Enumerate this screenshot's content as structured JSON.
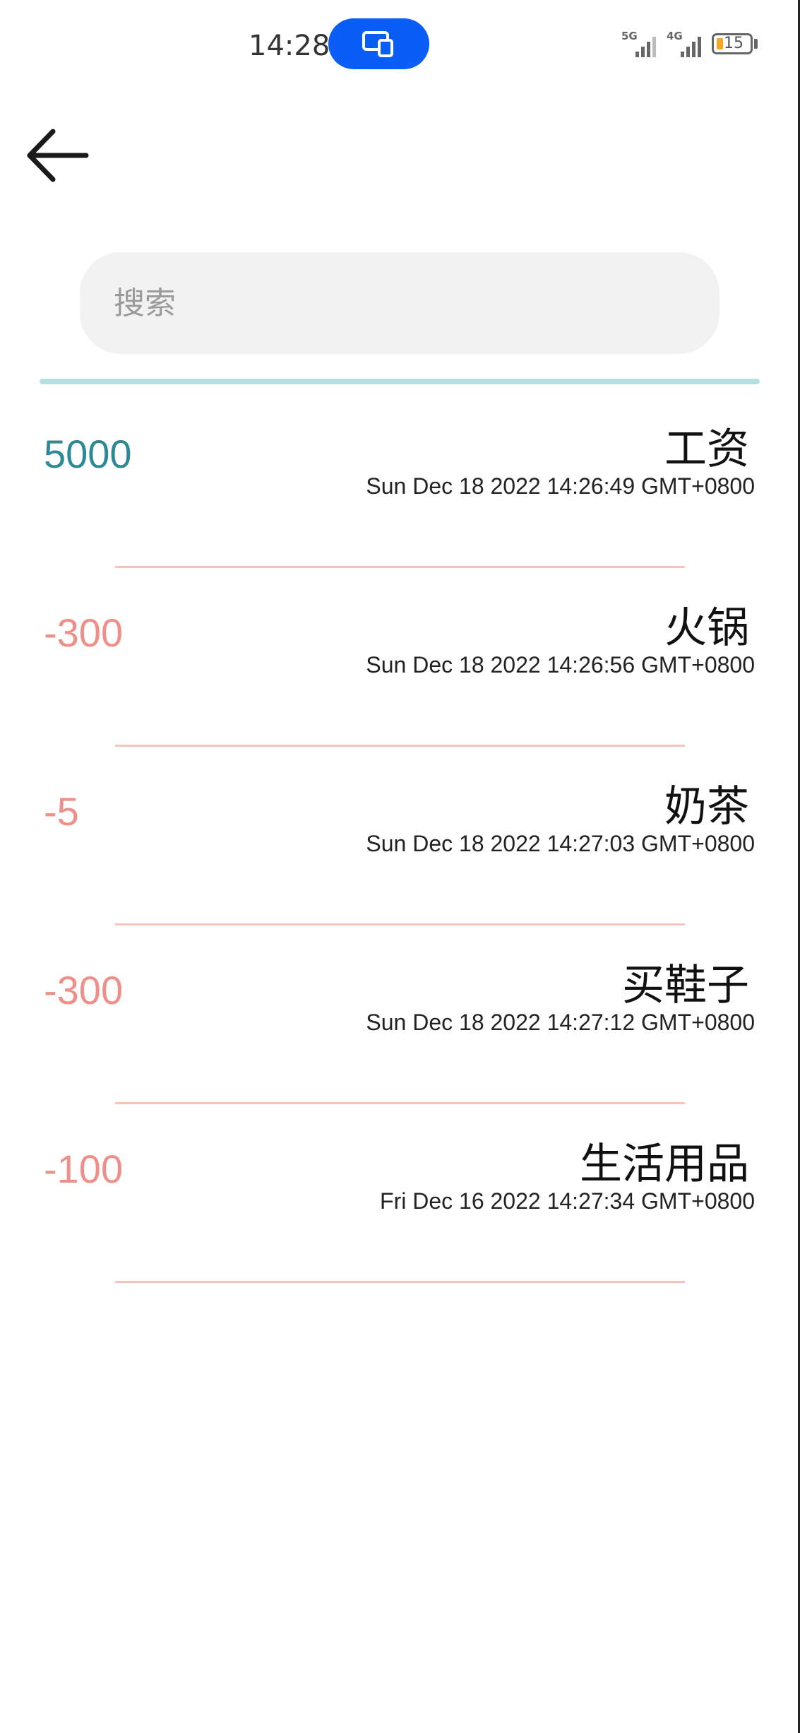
{
  "status_bar": {
    "time": "14:28",
    "network_1": "5G",
    "network_2": "4G",
    "battery_level": "15",
    "battery_fraction": 0.15
  },
  "search": {
    "placeholder": "搜索",
    "value": ""
  },
  "colors": {
    "income": "#2b8a96",
    "expense": "#ef8f8a",
    "underline": "#b3e0e1",
    "divider": "#f2c6bd",
    "accent": "#0a5ef7"
  },
  "records": [
    {
      "amount": "5000",
      "type": "income",
      "category": "工资",
      "date": "Sun Dec 18 2022 14:26:49 GMT+0800"
    },
    {
      "amount": "-300",
      "type": "expense",
      "category": "火锅",
      "date": "Sun Dec 18 2022 14:26:56 GMT+0800"
    },
    {
      "amount": "-5",
      "type": "expense",
      "category": "奶茶",
      "date": "Sun Dec 18 2022 14:27:03 GMT+0800"
    },
    {
      "amount": "-300",
      "type": "expense",
      "category": "买鞋子",
      "date": "Sun Dec 18 2022 14:27:12 GMT+0800"
    },
    {
      "amount": "-100",
      "type": "expense",
      "category": "生活用品",
      "date": "Fri Dec 16 2022 14:27:34 GMT+0800"
    }
  ]
}
